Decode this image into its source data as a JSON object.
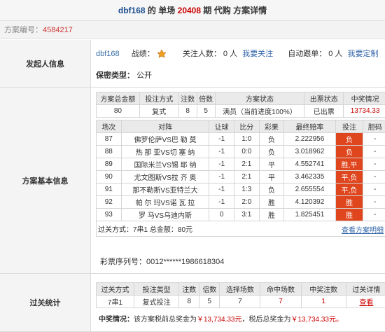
{
  "header": {
    "user": "dbf168",
    "de": "的",
    "game": "单场",
    "period": "20408",
    "period_suffix": "期",
    "action": "代购",
    "detail": "方案详情"
  },
  "project": {
    "label": "方案编号：",
    "id": "4584217"
  },
  "initiator": {
    "section_label": "发起人信息",
    "name": "dbf168",
    "record_label": "战绩：",
    "followers_label": "关注人数：",
    "followers": "0 人",
    "follow_link": "我要关注",
    "auto_label": "自动跟单：",
    "auto_count": "0 人",
    "auto_link": "我要定制",
    "privacy_label": "保密类型：",
    "privacy": "公开"
  },
  "basic": {
    "section_label": "方案基本信息",
    "summary_headers": [
      "方案总金额",
      "投注方式",
      "注数",
      "倍数",
      "方案状态",
      "出票状态",
      "中奖情况"
    ],
    "summary_row": [
      "80",
      "复式",
      "8",
      "5",
      "满员（当前进度100%）",
      "已出票",
      "13734.33"
    ],
    "match_headers": [
      "场次",
      "对阵",
      "让球",
      "比分",
      "彩果",
      "最终赔率",
      "投注",
      "胆码"
    ],
    "matches": [
      [
        "87",
        "佛罗伦萨VS巴 勒 莫",
        "-1",
        "1:0",
        "负",
        "2.222956",
        "负",
        "-"
      ],
      [
        "88",
        "热 那 亚VS切 塞 纳",
        "-1",
        "0:0",
        "负",
        "3.018962",
        "负",
        "-"
      ],
      [
        "89",
        "国际米兰VS锡 耶 纳",
        "-1",
        "2:1",
        "平",
        "4.552741",
        "胜,平",
        "-"
      ],
      [
        "90",
        "尤文图斯VS拉 齐 奥",
        "-1",
        "2:1",
        "平",
        "3.462335",
        "平,负",
        "-"
      ],
      [
        "91",
        "那不勒斯VS亚特兰大",
        "-1",
        "1:3",
        "负",
        "2.655554",
        "平,负",
        "-"
      ],
      [
        "92",
        "帕 尔 玛VS诺 瓦 拉",
        "-1",
        "2:0",
        "胜",
        "4.120392",
        "胜",
        "-"
      ],
      [
        "93",
        "罗 马VS乌迪内斯",
        "0",
        "3:1",
        "胜",
        "1.825451",
        "胜",
        "-"
      ]
    ],
    "footer_text": "过关方式：7串1 总金额：80元",
    "footer_link": "查看方案明细",
    "ticket_label": "彩票序列号：",
    "ticket_no": "0012******1986618304"
  },
  "stats": {
    "section_label": "过关统计",
    "headers": [
      "过关方式",
      "投注类型",
      "注数",
      "倍数",
      "选择场数",
      "命中场数",
      "中奖注数",
      "过关详情"
    ],
    "row": [
      "7串1",
      "复式投注",
      "8",
      "5",
      "7",
      "7",
      "1",
      "查看"
    ],
    "prize_label": "中奖情况：",
    "prize_text_1": "该方案税前总奖金为",
    "prize_pre": "￥13,734.33元",
    "prize_text_2": "，税后总奖金为",
    "prize_post": "￥13,734.33元。"
  }
}
